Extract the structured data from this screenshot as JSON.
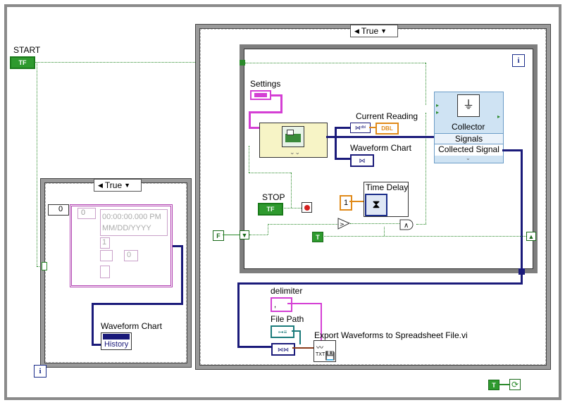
{
  "diagram": {
    "start_label": "START",
    "start_terminal_text": "TF",
    "outer_case_selector": "True",
    "inner_case_selector": "True",
    "settings_label": "Settings",
    "current_reading_label": "Current Reading",
    "dbl_label": "DBL",
    "waveform_chart_label": "Waveform Chart",
    "collector_title": "Collector",
    "collector_signals": "Signals",
    "collector_output": "Collected Signal",
    "stop_label": "STOP",
    "stop_terminal_text": "TF",
    "time_delay_label": "Time Delay",
    "time_delay_value": "1",
    "false_const": "F",
    "true_const": "T",
    "loop_iteration_symbol": "i",
    "left_case_numeric": "0",
    "left_case_inner_numeric": "0",
    "timestamp_text": "00:00:00.000 PM",
    "date_text": "MM/DD/YYYY",
    "cluster_value_1": "1",
    "cluster_value_2": "0",
    "left_waveform_chart_label": "Waveform Chart",
    "history_label": "History",
    "delimiter_label": "delimiter",
    "delimiter_value": ",",
    "file_path_label": "File Path",
    "export_vi_label": "Export Waveforms to Spreadsheet File.vi",
    "export_icon_text": "TXT",
    "bottom_true_const": "T"
  }
}
